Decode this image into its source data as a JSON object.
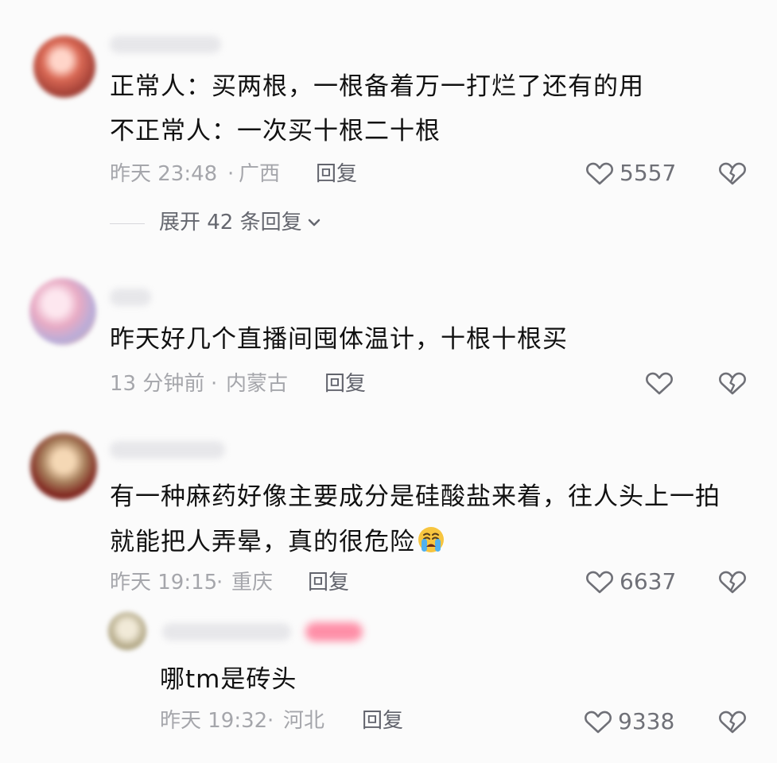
{
  "comments": [
    {
      "text_lines": [
        "正常人：买两根，一根备着万一打烂了还有的用",
        "不正常人：一次买十根二十根"
      ],
      "time": "昨天 23:48",
      "location": "广西",
      "reply_label": "回复",
      "likes": "5557",
      "expand_label": "展开 42 条回复"
    },
    {
      "text_lines": [
        "昨天好几个直播间囤体温计，十根十根买"
      ],
      "time": "13 分钟前",
      "location": "内蒙古",
      "reply_label": "回复",
      "likes": ""
    },
    {
      "text_lines": [
        "有一种麻药好像主要成分是硅酸盐来着，往人头上一拍",
        "就能把人弄晕，真的很危险"
      ],
      "time": "昨天 19:15",
      "location": "重庆",
      "reply_label": "回复",
      "likes": "6637",
      "emoji": "loudly-crying-face-icon"
    },
    {
      "text_lines": [
        "哪tm是砖头"
      ],
      "time": "昨天 19:32",
      "location": "河北",
      "reply_label": "回复",
      "likes": "9338"
    }
  ],
  "colors": {
    "background": "#fbfbfb",
    "text": "#111111",
    "muted": "#a5a6ab",
    "icon": "#6f7077"
  }
}
